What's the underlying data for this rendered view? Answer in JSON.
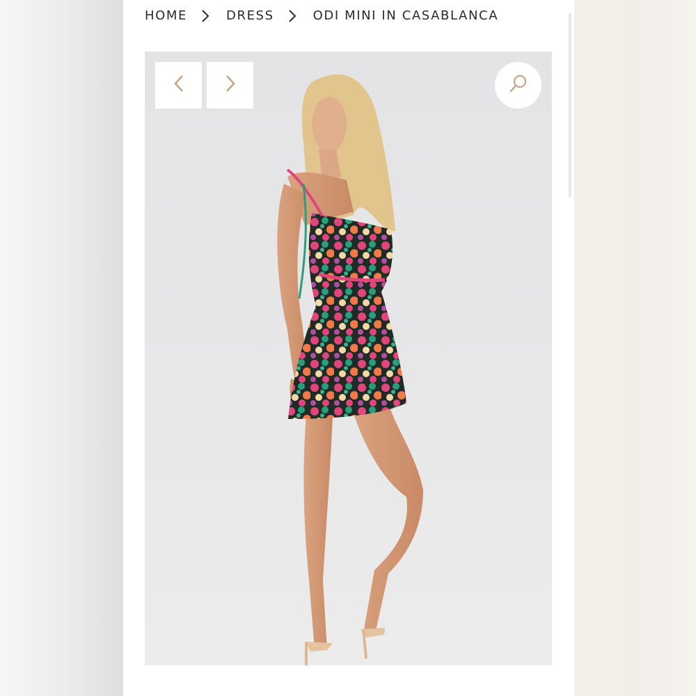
{
  "breadcrumb": {
    "items": [
      {
        "label": "HOME"
      },
      {
        "label": "DRESS"
      },
      {
        "label": "ODI MINI IN CASABLANCA"
      }
    ],
    "separator_icon": "chevron-right-icon"
  },
  "gallery": {
    "prev_icon": "chevron-left-icon",
    "next_icon": "chevron-right-icon",
    "zoom_icon": "magnifier-icon",
    "control_accent": "#c9a384"
  }
}
